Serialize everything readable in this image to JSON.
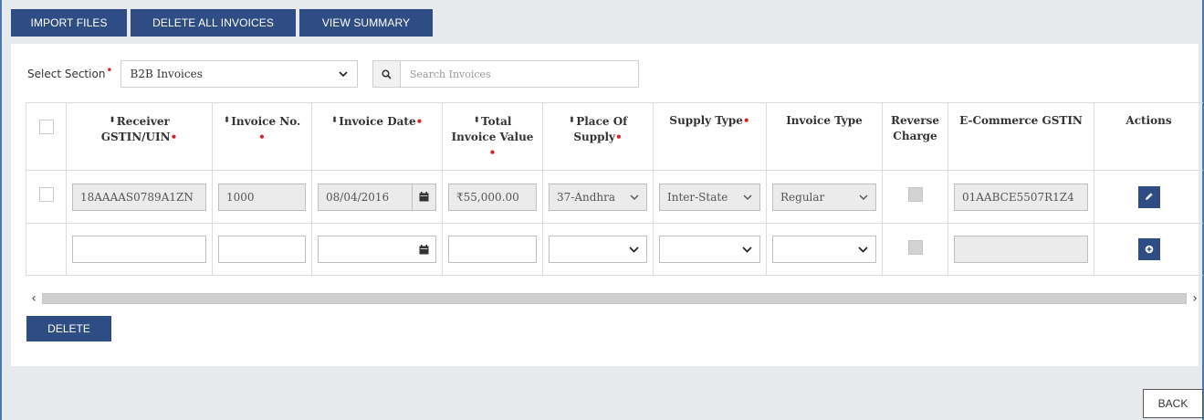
{
  "toolbar": {
    "import_label": "IMPORT FILES",
    "delete_all_label": "DELETE ALL INVOICES",
    "view_summary_label": "VIEW SUMMARY"
  },
  "section": {
    "label": "Select Section",
    "selected": "B2B Invoices"
  },
  "search": {
    "placeholder": "Search Invoices"
  },
  "table": {
    "headers": {
      "receiver_l1": "Receiver",
      "receiver_l2": "GSTIN/UIN",
      "invoice_no": "Invoice No.",
      "invoice_date": "Invoice Date",
      "total_l1": "Total",
      "total_l2": "Invoice Value",
      "place_l1": "Place Of",
      "place_l2": "Supply",
      "supply_type": "Supply Type",
      "invoice_type": "Invoice Type",
      "reverse_l1": "Reverse",
      "reverse_l2": "Charge",
      "ecom_gstin": "E-Commerce GSTIN",
      "actions": "Actions"
    },
    "row1": {
      "receiver_gstin": "18AAAAS0789A1ZN",
      "invoice_no": "1000",
      "invoice_date": "08/04/2016",
      "total_value": "₹55,000.00",
      "place_of_supply": "37-Andhra",
      "supply_type": "Inter-State",
      "invoice_type": "Regular",
      "ecom_gstin": "01AABCE5507R1Z4"
    }
  },
  "buttons": {
    "delete_label": "DELETE",
    "back_label": "BACK"
  },
  "colors": {
    "primary": "#2e4d84",
    "required": "#e02020",
    "frame_border": "#4a78b3"
  }
}
